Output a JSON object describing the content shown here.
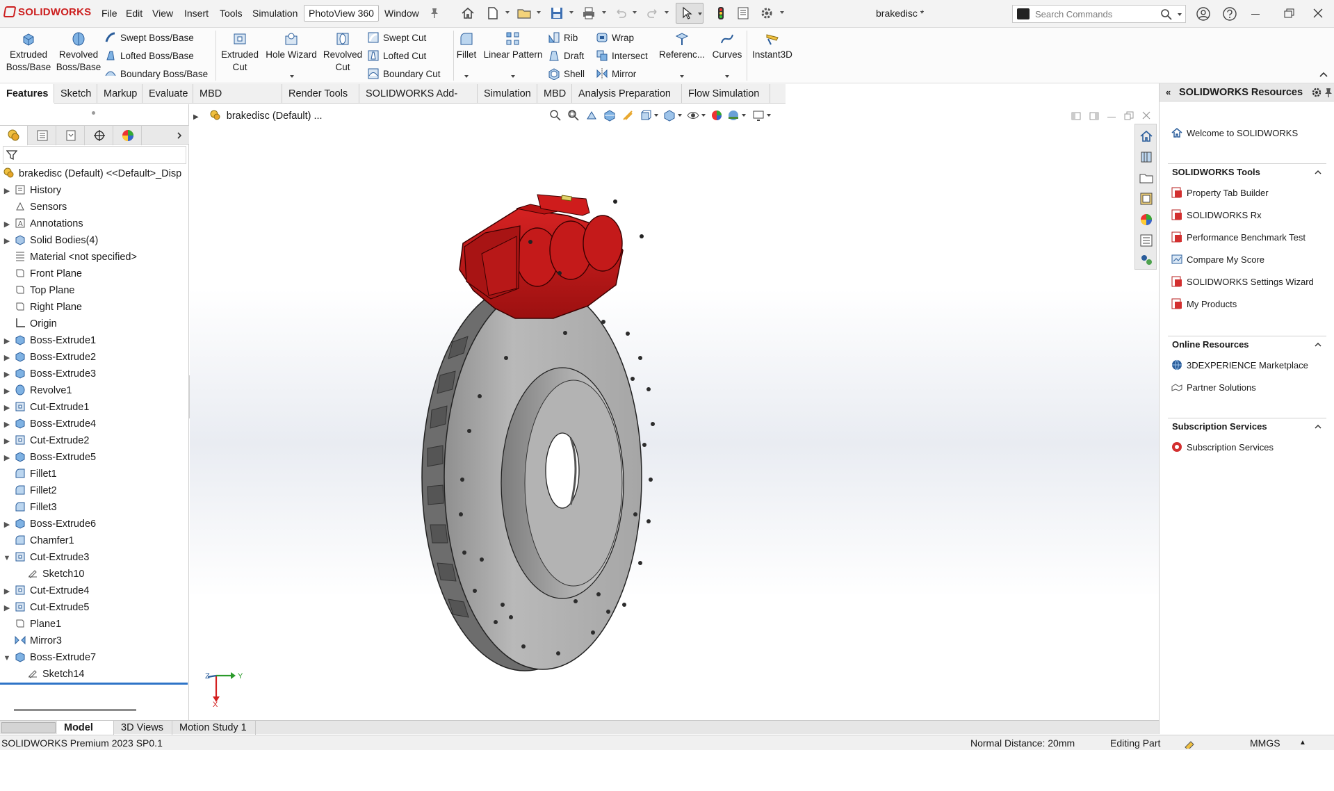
{
  "app": {
    "logo_text": "SOLIDWORKS",
    "document_title": "brakedisc *"
  },
  "menu": {
    "file": "File",
    "edit": "Edit",
    "view": "View",
    "insert": "Insert",
    "tools": "Tools",
    "simulation": "Simulation",
    "photoview": "PhotoView 360",
    "window": "Window"
  },
  "search": {
    "placeholder": "Search Commands"
  },
  "commands": {
    "extruded_boss": [
      "Extruded",
      "Boss/Base"
    ],
    "revolved_boss": [
      "Revolved",
      "Boss/Base"
    ],
    "swept_boss": "Swept Boss/Base",
    "lofted_boss": "Lofted Boss/Base",
    "boundary_boss": "Boundary Boss/Base",
    "extruded_cut": [
      "Extruded",
      "Cut"
    ],
    "hole_wizard": "Hole Wizard",
    "revolved_cut": [
      "Revolved",
      "Cut"
    ],
    "swept_cut": "Swept Cut",
    "lofted_cut": "Lofted Cut",
    "boundary_cut": "Boundary Cut",
    "fillet": "Fillet",
    "linear_pattern": "Linear Pattern",
    "rib": "Rib",
    "draft": "Draft",
    "shell": "Shell",
    "wrap": "Wrap",
    "intersect": "Intersect",
    "mirror": "Mirror",
    "reference": "Referenc...",
    "curves": "Curves",
    "instant3d": "Instant3D"
  },
  "cm_tabs": [
    "Features",
    "Sketch",
    "Markup",
    "Evaluate",
    "MBD Dimensions",
    "Render Tools",
    "SOLIDWORKS Add-Ins",
    "Simulation",
    "MBD",
    "Analysis Preparation",
    "Flow Simulation"
  ],
  "tree": {
    "root": "brakedisc (Default) <<Default>_Disp",
    "items": [
      "History",
      "Sensors",
      "Annotations",
      "Solid Bodies(4)",
      "Material <not specified>",
      "Front Plane",
      "Top Plane",
      "Right Plane",
      "Origin",
      "Boss-Extrude1",
      "Boss-Extrude2",
      "Boss-Extrude3",
      "Revolve1",
      "Cut-Extrude1",
      "Boss-Extrude4",
      "Cut-Extrude2",
      "Boss-Extrude5",
      "Fillet1",
      "Fillet2",
      "Fillet3",
      "Boss-Extrude6",
      "Chamfer1",
      "Cut-Extrude3",
      "Sketch10",
      "Cut-Extrude4",
      "Cut-Extrude5",
      "Plane1",
      "Mirror3",
      "Boss-Extrude7",
      "Sketch14"
    ]
  },
  "viewport": {
    "breadcrumb": "brakedisc (Default) ...",
    "triad_x": "X",
    "triad_y": "Y",
    "triad_z": "Z"
  },
  "resources": {
    "title": "SOLIDWORKS Resources",
    "welcome": "Welcome to SOLIDWORKS",
    "tools_title": "SOLIDWORKS Tools",
    "tools": [
      "Property Tab Builder",
      "SOLIDWORKS Rx",
      "Performance Benchmark Test",
      "Compare My Score",
      "SOLIDWORKS Settings Wizard",
      "My Products"
    ],
    "online_title": "Online Resources",
    "online": [
      "3DEXPERIENCE Marketplace",
      "Partner Solutions"
    ],
    "sub_title": "Subscription Services",
    "sub": [
      "Subscription Services"
    ]
  },
  "bottom_tabs": [
    "Model",
    "3D Views",
    "Motion Study 1"
  ],
  "status": {
    "product": "SOLIDWORKS Premium 2023 SP0.1",
    "distance": "Normal Distance: 20mm",
    "mode": "Editing Part",
    "units": "MMGS"
  },
  "colors": {
    "caliper": "#c41a1a",
    "disc": "#a9a9a9",
    "accent": "#2e74c7",
    "brand": "#cc1f1f"
  }
}
